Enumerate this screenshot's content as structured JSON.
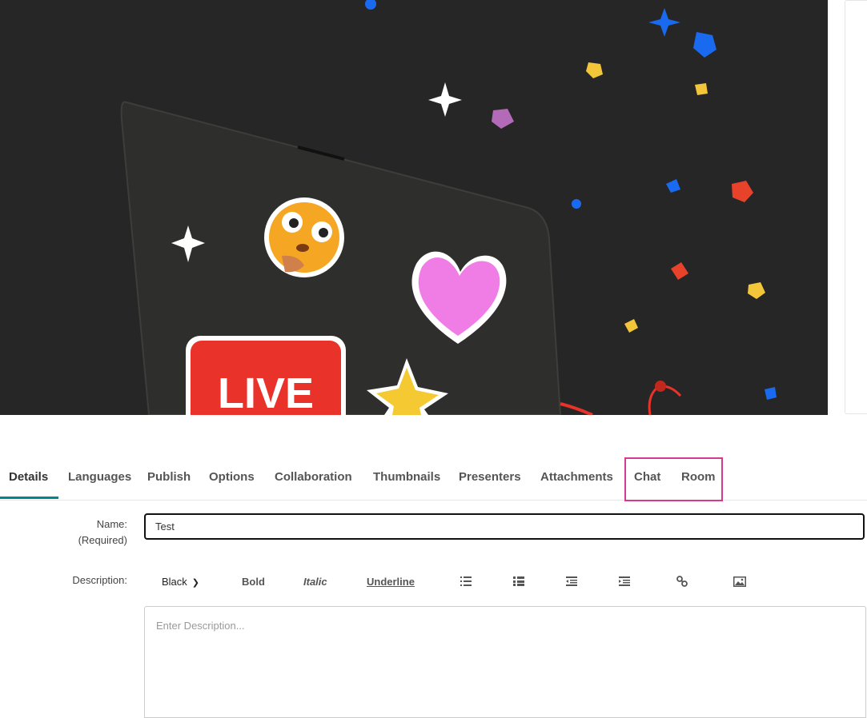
{
  "tabs": [
    {
      "label": "Details",
      "active": true
    },
    {
      "label": "Languages"
    },
    {
      "label": "Publish"
    },
    {
      "label": "Options"
    },
    {
      "label": "Collaboration"
    },
    {
      "label": "Thumbnails"
    },
    {
      "label": "Presenters"
    },
    {
      "label": "Attachments"
    },
    {
      "label": "Chat"
    },
    {
      "label": "Room"
    }
  ],
  "hero": {
    "sticker_text": "LIVE"
  },
  "form": {
    "name_label": "Name:",
    "name_required": "(Required)",
    "name_value": "Test",
    "description_label": "Description:",
    "description_placeholder": "Enter Description..."
  },
  "toolbar": {
    "color_value": "Black",
    "bold": "Bold",
    "italic": "Italic",
    "underline": "Underline",
    "icons": [
      "bullet-list-icon",
      "numbered-list-icon",
      "outdent-icon",
      "indent-icon",
      "link-icon",
      "image-icon"
    ]
  },
  "colors": {
    "accent": "#00868b",
    "highlight": "#d63a8d",
    "live_red": "#e8322a",
    "heart_pink": "#f07de6"
  }
}
